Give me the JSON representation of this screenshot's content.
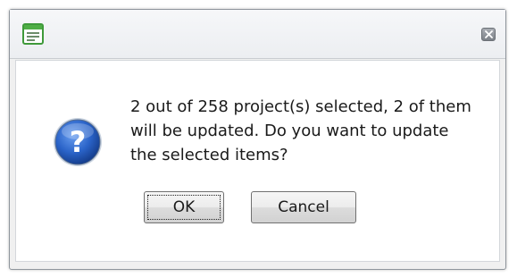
{
  "dialog": {
    "title_icon": "window-app-icon",
    "close_icon": "close-icon",
    "message": "2 out of 258 project(s) selected, 2 of them will be updated. Do you want to update the selected items?",
    "message_icon": "question-icon",
    "buttons": {
      "ok_label": "OK",
      "cancel_label": "Cancel"
    }
  },
  "colors": {
    "question_icon_blue": "#1f56b8",
    "app_icon_green": "#3f9a3a"
  }
}
